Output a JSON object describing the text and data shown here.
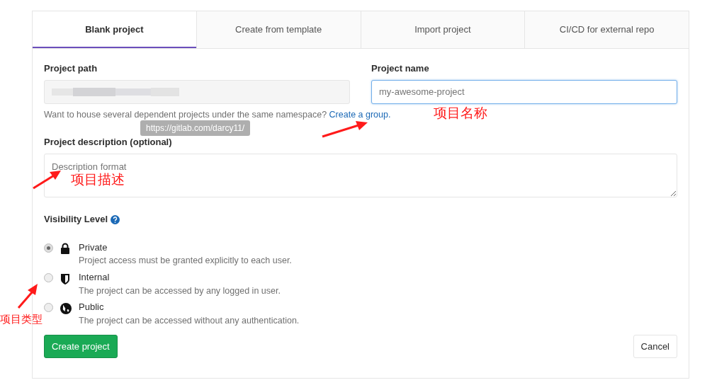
{
  "tabs": [
    {
      "label": "Blank project",
      "selected": true
    },
    {
      "label": "Create from template",
      "selected": false
    },
    {
      "label": "Import project",
      "selected": false
    },
    {
      "label": "CI/CD for external repo",
      "selected": false
    }
  ],
  "project_path": {
    "label": "Project path",
    "tooltip": "https://gitlab.com/darcy11/",
    "help": "Want to house several dependent projects under the same namespace?",
    "help_link": "Create a group."
  },
  "project_name": {
    "label": "Project name",
    "placeholder": "my-awesome-project",
    "focused": true
  },
  "description": {
    "label": "Project description (optional)",
    "placeholder": "Description format"
  },
  "visibility": {
    "label": "Visibility Level",
    "options": [
      {
        "kind": "lock",
        "title": "Private",
        "text": "Project access must be granted explicitly to each user.",
        "selected": true
      },
      {
        "kind": "shield",
        "title": "Internal",
        "text": "The project can be accessed by any logged in user.",
        "selected": false
      },
      {
        "kind": "globe",
        "title": "Public",
        "text": "The project can be accessed without any authentication.",
        "selected": false
      }
    ]
  },
  "buttons": [
    {
      "label": "Create project",
      "kind": "primary"
    },
    {
      "label": "Cancel",
      "kind": "default"
    }
  ],
  "annotations": [
    {
      "text": "项目名称"
    },
    {
      "text": "项目描述"
    },
    {
      "text": "项目类型"
    }
  ]
}
